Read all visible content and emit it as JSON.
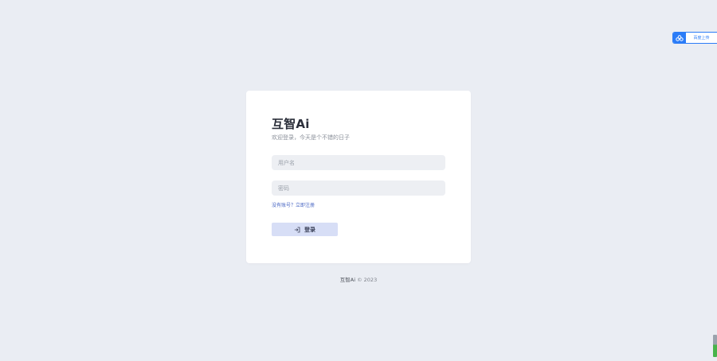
{
  "login": {
    "brand": "互智Ai",
    "welcome": "欢迎登录，今天是个不错的日子",
    "username_placeholder": "用户名",
    "password_placeholder": "密码",
    "register_text": "没有账号？立即注册",
    "login_button": "登录"
  },
  "footer": {
    "brand": "互智Ai",
    "copyright": " © 2023"
  },
  "upload_widget": {
    "label": "百度上传"
  },
  "colors": {
    "background": "#eaedf3",
    "card": "#ffffff",
    "input_bg": "#edeff3",
    "button_bg": "#d7def6",
    "link": "#4a67c4",
    "accent": "#2b7cf7"
  }
}
